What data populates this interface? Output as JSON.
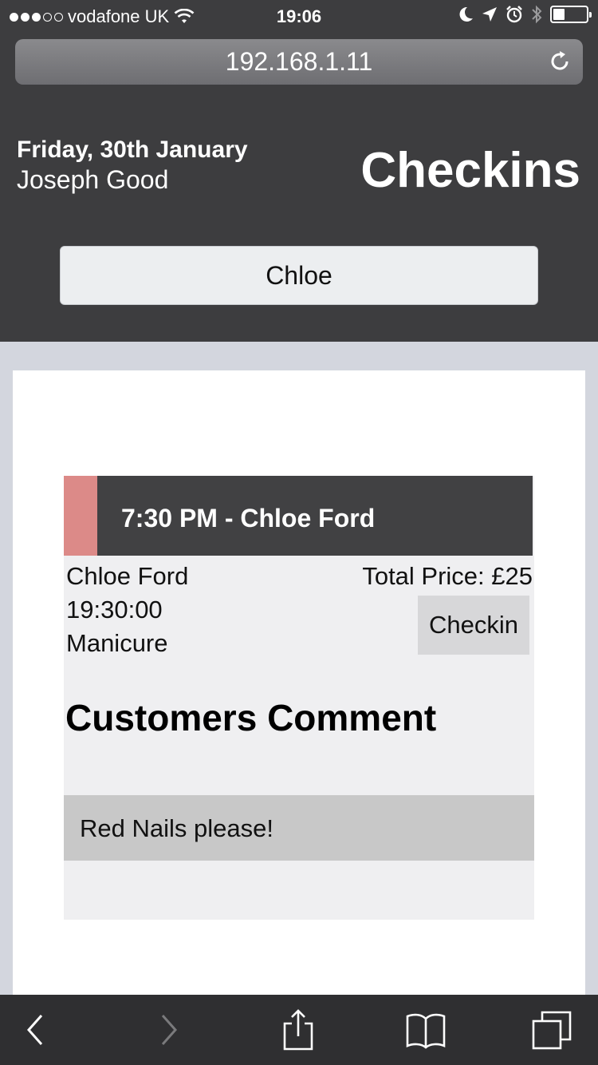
{
  "status_bar": {
    "carrier": "vodafone UK",
    "time": "19:06",
    "signal_bars_filled": 3,
    "signal_bars_total": 5
  },
  "browser": {
    "url": "192.168.1.11"
  },
  "header": {
    "date": "Friday, 30th January",
    "user": "Joseph Good",
    "title": "Checkins"
  },
  "search": {
    "value": "Chloe"
  },
  "appointment": {
    "title": "7:30 PM - Chloe Ford",
    "customer": "Chloe Ford",
    "time": "19:30:00",
    "service": "Manicure",
    "total_price": "Total Price: £25",
    "checkin_label": "Checkin",
    "accent_color": "#dc8a88",
    "comment_heading": "Customers Comment",
    "comment": "Red Nails please!"
  },
  "toolbar": {
    "icons": [
      "back-icon",
      "forward-icon",
      "share-icon",
      "bookmarks-icon",
      "tabs-icon"
    ]
  }
}
